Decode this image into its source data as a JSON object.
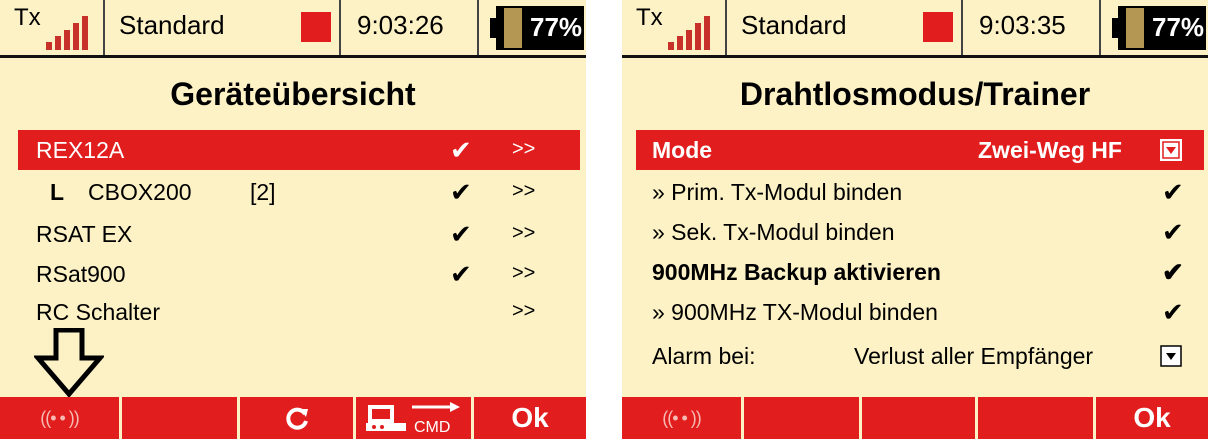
{
  "colors": {
    "background": "#fdf2c5",
    "accent_red": "#e11d1d",
    "battery_fill": "#b39752",
    "signal_bars": "#c8302a"
  },
  "screen_left": {
    "status": {
      "tx": "Tx",
      "profile": "Standard",
      "time": "9:03:26",
      "battery": "77%"
    },
    "title": "Geräteübersicht",
    "rows": [
      {
        "label": "REX12A",
        "check": "✔",
        "arrow": ">>",
        "index": ""
      },
      {
        "label": "CBOX200",
        "check": "✔",
        "arrow": ">>",
        "index": "[2]",
        "tree": "L"
      },
      {
        "label": "RSAT EX",
        "check": "✔",
        "arrow": ">>",
        "index": ""
      },
      {
        "label": "RSat900",
        "check": "✔",
        "arrow": ">>",
        "index": ""
      },
      {
        "label": "RC Schalter",
        "check": "",
        "arrow": ">>",
        "index": ""
      }
    ],
    "bottom_bar": {
      "buttons": [
        {
          "icon": "wireless-signal-icon",
          "label": "((• • ))"
        },
        {
          "icon": "",
          "label": ""
        },
        {
          "icon": "refresh-icon",
          "label": ""
        },
        {
          "icon": "cmd-device-icon",
          "label": "CMD"
        },
        {
          "icon": "",
          "label": "Ok"
        }
      ]
    }
  },
  "screen_right": {
    "status": {
      "tx": "Tx",
      "profile": "Standard",
      "time": "9:03:35",
      "battery": "77%"
    },
    "title": "Drahtlosmodus/Trainer",
    "rows": [
      {
        "label": "Mode",
        "value": "Zwei-Weg HF",
        "bold": true
      },
      {
        "label": "» Prim. Tx-Modul binden",
        "check": "✔"
      },
      {
        "label": "» Sek. Tx-Modul binden",
        "check": "✔"
      },
      {
        "label": "900MHz Backup aktivieren",
        "check": "✔",
        "bold": true
      },
      {
        "label": "» 900MHz TX-Modul binden",
        "check": "✔"
      },
      {
        "label": "Alarm bei:",
        "value": "Verlust aller Empfänger"
      }
    ],
    "bottom_bar": {
      "buttons": [
        {
          "icon": "wireless-signal-icon",
          "label": "((• • ))"
        },
        {
          "icon": "",
          "label": ""
        },
        {
          "icon": "",
          "label": ""
        },
        {
          "icon": "",
          "label": ""
        },
        {
          "icon": "",
          "label": "Ok"
        }
      ]
    }
  }
}
